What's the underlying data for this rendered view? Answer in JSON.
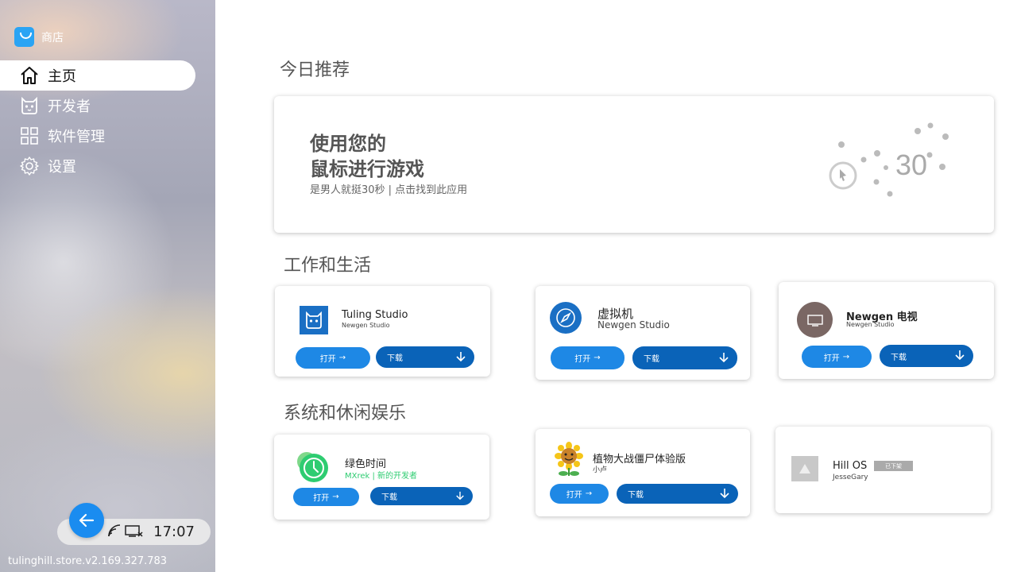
{
  "store": {
    "title": "商店"
  },
  "nav": [
    {
      "label": "主页",
      "icon": "home-icon"
    },
    {
      "label": "开发者",
      "icon": "developer-cat-icon"
    },
    {
      "label": "软件管理",
      "icon": "grid-icon"
    },
    {
      "label": "设置",
      "icon": "gear-icon"
    }
  ],
  "status": {
    "clock": "17:07",
    "wifi_icon": "wifi-icon",
    "display_icon": "display-off-icon"
  },
  "version": "tulinghill.store.v2.169.327.783",
  "sections": {
    "today": "今日推荐",
    "work": "工作和生活",
    "system": "系统和休闲娱乐"
  },
  "hero": {
    "line1": "使用您的",
    "line2": "鼠标进行游戏",
    "subtitle": "是男人就挺30秒 | 点击找到此应用",
    "art_number": "30"
  },
  "buttons": {
    "open": "打开",
    "download": "下载"
  },
  "apps": {
    "tuling": {
      "name": "Tuling Studio",
      "dev": "Newgen Studio"
    },
    "vm": {
      "name": "虚拟机",
      "dev": "Newgen Studio"
    },
    "tv": {
      "name": "Newgen 电视",
      "dev": "Newgen Studio"
    },
    "green": {
      "name": "绿色时间",
      "dev": "MXrek | 新的开发者"
    },
    "pvz": {
      "name": "植物大战僵尸体验版",
      "dev": "小卢"
    },
    "hill": {
      "name": "Hill OS",
      "dev": "JesseGary",
      "badge": "已下架"
    }
  },
  "colors": {
    "accent": "#1e88e5",
    "download": "#0a63b8",
    "green": "#2ecc71"
  }
}
